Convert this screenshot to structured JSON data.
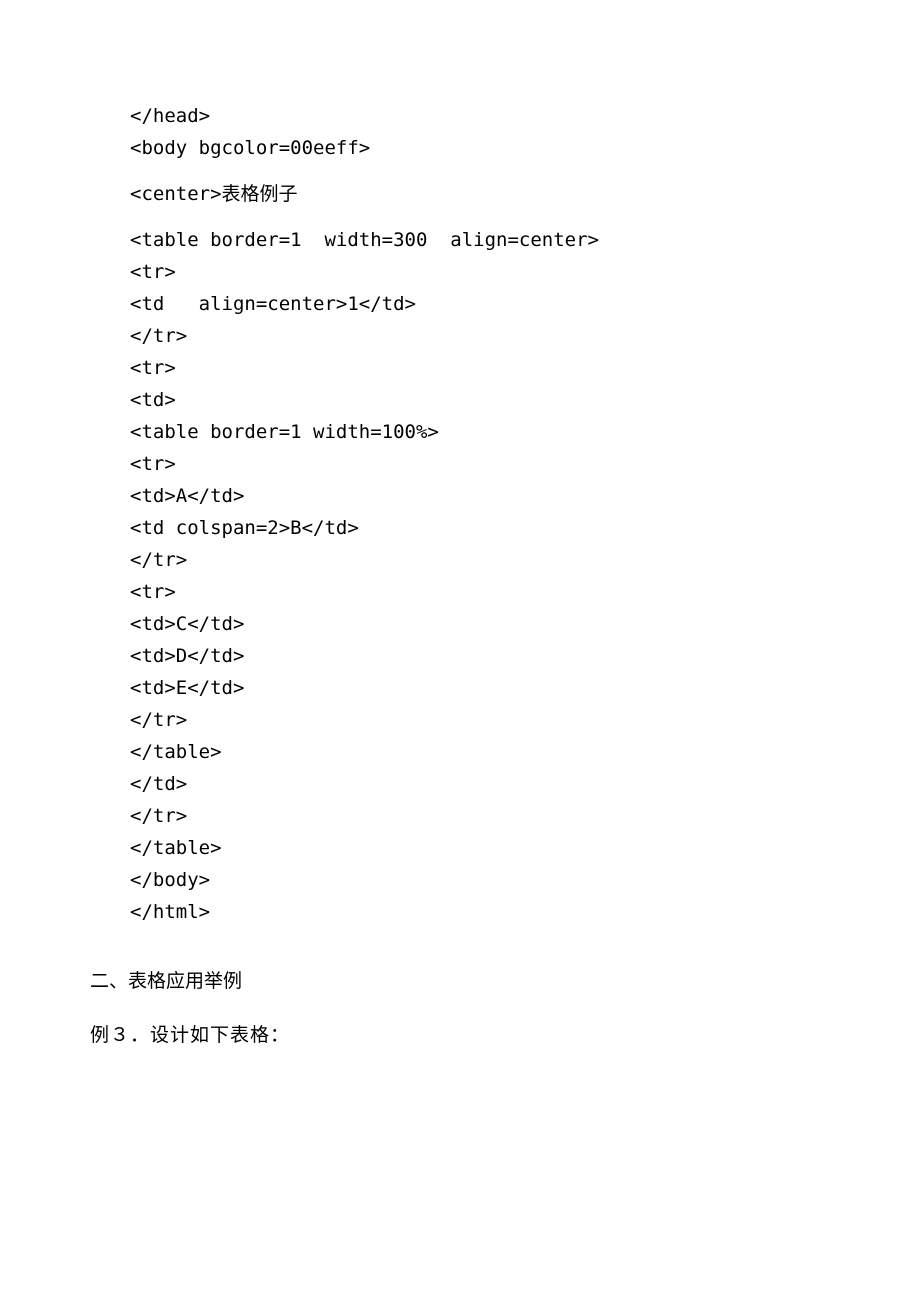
{
  "code": {
    "lines": [
      "</head>",
      "<body bgcolor=00eeff>",
      "",
      "<center>表格例子",
      "",
      "<table border=1  width=300  align=center>",
      "<tr>",
      "<td   align=center>1</td>",
      "</tr>",
      "<tr>",
      "<td>",
      "<table border=1 width=100%>",
      "<tr>",
      "<td>A</td>",
      "<td colspan=2>B</td>",
      "</tr>",
      "<tr>",
      "<td>C</td>",
      "<td>D</td>",
      "<td>E</td>",
      "</tr>",
      "</table>",
      "</td>",
      "</tr>",
      "</table>",
      "</body>",
      "</html>"
    ]
  },
  "section": {
    "heading": "二、表格应用举例",
    "example": "例３．设计如下表格："
  }
}
